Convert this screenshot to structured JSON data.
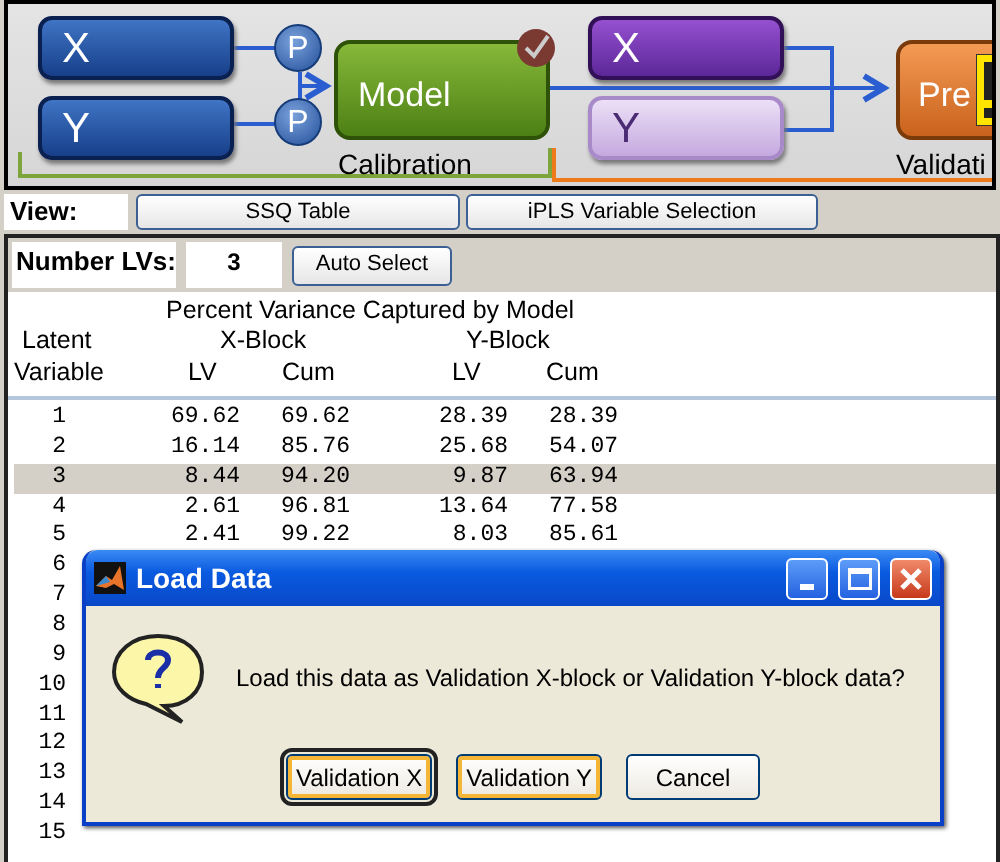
{
  "flow": {
    "calibration": {
      "blocks": [
        {
          "label": "X",
          "loaded": true
        },
        {
          "label": "Y",
          "loaded": true
        }
      ],
      "preprocess": [
        "P",
        "P"
      ],
      "model": "Model",
      "model_checked": true,
      "label": "Calibration"
    },
    "validation": {
      "blocks": [
        {
          "label": "X",
          "loaded": true
        },
        {
          "label": "Y",
          "loaded": false
        }
      ],
      "predict": "Pre",
      "warning": true,
      "label": "Validati"
    }
  },
  "view": {
    "label": "View:",
    "buttons": [
      "SSQ Table",
      "iPLS Variable Selection"
    ]
  },
  "lvs": {
    "label": "Number LVs:",
    "value": "3",
    "button": "Auto Select"
  },
  "table": {
    "title": "Percent Variance Captured by Model",
    "header_row_1": [
      "Latent",
      "X-Block",
      "Y-Block"
    ],
    "header_row_2": [
      "Variable",
      "LV",
      "Cum",
      "LV",
      "Cum"
    ],
    "rows": [
      {
        "cells": [
          "1",
          "69.62",
          "69.62",
          "28.39",
          "28.39"
        ],
        "selected": false
      },
      {
        "cells": [
          "2",
          "16.14",
          "85.76",
          "25.68",
          "54.07"
        ],
        "selected": false
      },
      {
        "cells": [
          "3",
          "8.44",
          "94.20",
          "9.87",
          "63.94"
        ],
        "selected": true
      },
      {
        "cells": [
          "4",
          "2.61",
          "96.81",
          "13.64",
          "77.58"
        ],
        "selected": false
      },
      {
        "cells": [
          "5",
          "2.41",
          "99.22",
          "8.03",
          "85.61"
        ],
        "selected": false
      },
      {
        "cells": [
          "6"
        ],
        "selected": false
      },
      {
        "cells": [
          "7"
        ],
        "selected": false
      },
      {
        "cells": [
          "8"
        ],
        "selected": false
      },
      {
        "cells": [
          "9"
        ],
        "selected": false
      },
      {
        "cells": [
          "10"
        ],
        "selected": false
      },
      {
        "cells": [
          "11"
        ],
        "selected": false
      },
      {
        "cells": [
          "12"
        ],
        "selected": false
      },
      {
        "cells": [
          "13"
        ],
        "selected": false
      },
      {
        "cells": [
          "14"
        ],
        "selected": false
      },
      {
        "cells": [
          "15"
        ],
        "selected": false
      }
    ]
  },
  "dialog": {
    "title": "Load Data",
    "message": "Load this data as Validation X-block or Validation Y-block data?",
    "buttons": [
      {
        "label": "Validation X",
        "default": true,
        "highlighted": true
      },
      {
        "label": "Validation Y",
        "default": false,
        "highlighted": true
      },
      {
        "label": "Cancel",
        "default": false,
        "highlighted": false
      }
    ]
  }
}
